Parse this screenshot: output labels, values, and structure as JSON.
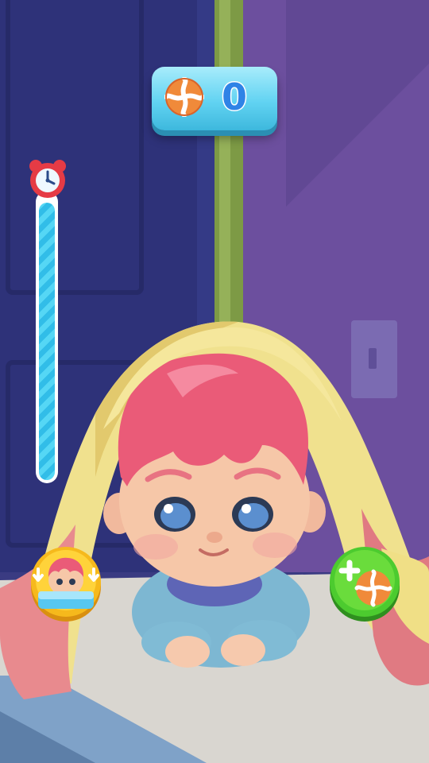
{
  "hud": {
    "candy_icon": "orange-candy-icon",
    "candy_count": "0",
    "timer_icon": "alarm-clock-icon",
    "timer_level": 0.97
  },
  "buttons": {
    "wake_up_icon": "baby-wake-icon",
    "add_candy_icon": "add-candy-icon"
  },
  "colors": {
    "counter_bg": "#62d3f2",
    "count_text": "#2f83e6",
    "timer_fill": "#31bde8",
    "alarm_red": "#e53b45",
    "wake_button": "#f6b91c",
    "add_button": "#4ccb2f",
    "hair": "#ea5b78"
  }
}
